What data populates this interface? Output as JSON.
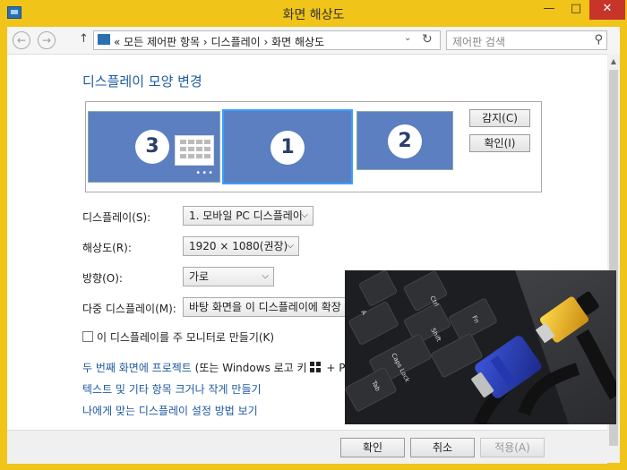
{
  "window": {
    "title": "화면 해상도",
    "minimize": "—",
    "maximize": "□",
    "close": "✕"
  },
  "nav": {
    "back": "←",
    "forward": "→",
    "up": "↑",
    "address": "«  모든 제어판 항목  ›  디스플레이  ›  화면 해상도",
    "dropdown": "⌄",
    "refresh": "↻",
    "search_placeholder": "제어판 검색"
  },
  "heading": "디스플레이 모양 변경",
  "monitors": [
    {
      "number": "3",
      "dots": "•••"
    },
    {
      "number": "1"
    },
    {
      "number": "2"
    }
  ],
  "side_buttons": {
    "detect": "감지(C)",
    "identify": "확인(I)"
  },
  "fields": {
    "display": {
      "label": "디스플레이(S):",
      "value": "1. 모바일 PC 디스플레이"
    },
    "resolution": {
      "label": "해상도(R):",
      "value": "1920 × 1080(권장)"
    },
    "orientation": {
      "label": "방향(O):",
      "value": "가로"
    },
    "multiple": {
      "label": "다중 디스플레이(M):",
      "value": "바탕 화면을 이 디스플레이에 확장"
    }
  },
  "checkbox": {
    "label": "이 디스플레이를 주 모니터로 만들기(K)",
    "checked": false
  },
  "links": {
    "project_prefix": "두 번째 화면에 프로젝트",
    "project_suffix": " (또는 Windows 로고 키",
    "project_tail": " + P 키",
    "text_size": "텍스트 및 기타 항목 크거나 작게 만들기",
    "which_settings": "나에게 맞는 디스플레이 설정 방법 보기"
  },
  "buttons": {
    "ok": "확인",
    "cancel": "취소",
    "apply": "적용(A)"
  },
  "photo": {
    "keys": [
      "Ctrl",
      "Shift",
      "Caps Lock",
      "Tab",
      "A",
      "Fn"
    ]
  },
  "colors": {
    "frame": "#f0c419",
    "link": "#1e5aa0",
    "monitor": "#5b7fc0",
    "close": "#c7352a",
    "selected_border": "#3aa0ff"
  }
}
